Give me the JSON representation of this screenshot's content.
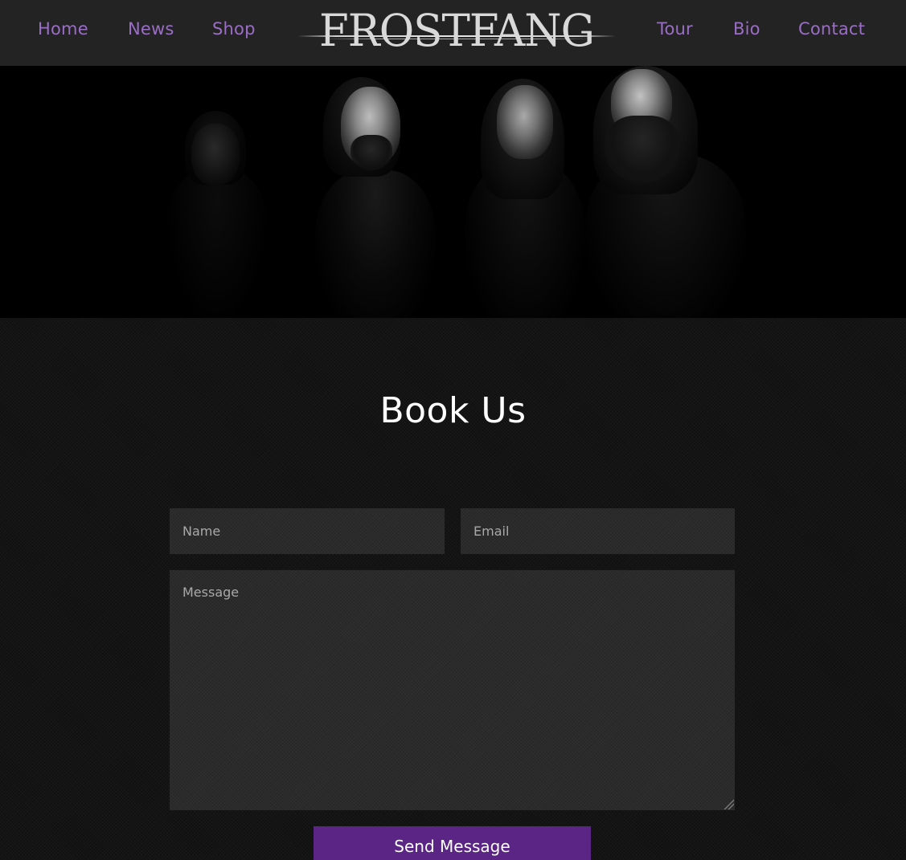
{
  "nav": {
    "left_links": [
      "Home",
      "News",
      "Shop"
    ],
    "right_links": [
      "Tour",
      "Bio",
      "Contact"
    ],
    "logo_text": "FROSTFANG",
    "link_color": "#9b6ec6"
  },
  "hero": {
    "image": "band-photo"
  },
  "booking": {
    "title": "Book Us",
    "name_placeholder": "Name",
    "email_placeholder": "Email",
    "message_placeholder": "Message",
    "send_label": "Send Message",
    "button_color": "#5b2585"
  }
}
